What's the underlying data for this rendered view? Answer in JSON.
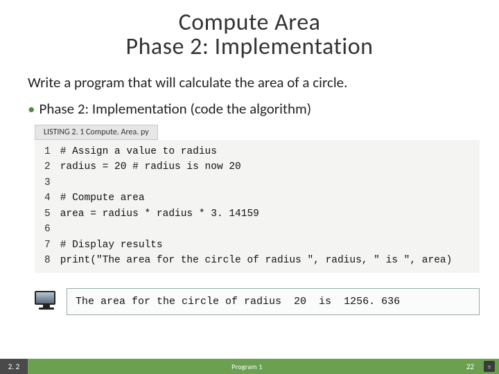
{
  "title": {
    "line1": "Compute Area",
    "line2": "Phase 2: Implementation"
  },
  "prompt": "Write a program that will calculate the area of a circle.",
  "bullet": "Phase 2: Implementation (code the algorithm)",
  "listing_tab": "LISTING 2. 1 Compute. Area. py",
  "code": {
    "line_numbers": [
      "1",
      "2",
      "3",
      "4",
      "5",
      "6",
      "7",
      "8"
    ],
    "lines": [
      "# Assign a value to radius",
      "radius = 20 # radius is now 20",
      "",
      "# Compute area",
      "area = radius * radius * 3. 14159",
      "",
      "# Display results",
      "print(\"The area for the circle of radius \", radius, \" is \", area)"
    ]
  },
  "output": "The area for the circle of radius  20  is  1256. 636",
  "footer": {
    "left": "2. 2",
    "center": "Program 1",
    "right": "22"
  }
}
